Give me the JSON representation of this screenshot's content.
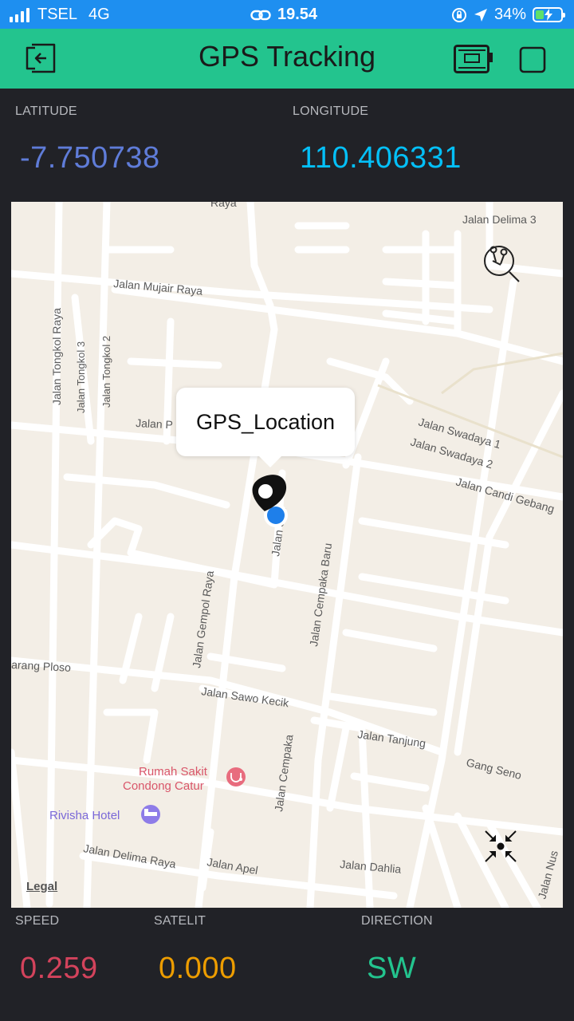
{
  "status_bar": {
    "carrier": "TSEL",
    "network": "4G",
    "time": "19.54",
    "battery_percent": "34%",
    "battery_level": 0.34
  },
  "header": {
    "title": "GPS Tracking",
    "back_icon": "exit-icon",
    "device_icon": "device-board-icon",
    "square_icon": "square-icon"
  },
  "coordinates": {
    "latitude_label": "LATITUDE",
    "latitude_value": "-7.750738",
    "longitude_label": "LONGITUDE",
    "longitude_value": "110.406331"
  },
  "map": {
    "marker_popup": "GPS_Location",
    "legal": "Legal",
    "streets": [
      "Jalan Delima 3",
      "Jalan Mujair Raya",
      "Jalan Tongkol Raya",
      "Jalan Tongkol 3",
      "Jalan Tongkol 2",
      "Jalan P",
      "Jalan Swadaya 1",
      "Jalan Swadaya 2",
      "Jalan Candi Gebang",
      "Jalan Cempaka Baru",
      "Jalan Gempol Raya",
      "arang Ploso",
      "Jalan Sawo Kecik",
      "Jalan Tanjung",
      "Gang Seno",
      "Jalan Cempaka",
      "Jalan Delima Raya",
      "Jalan Apel",
      "Jalan Dahlia",
      "Jalan Nus",
      "Jalan Sari",
      "Raya"
    ],
    "pois": {
      "hospital_line1": "Rumah Sakit",
      "hospital_line2": "Condong Catur",
      "hotel": "Rivisha Hotel"
    },
    "icons": [
      "map-search-icon",
      "recenter-icon",
      "hospital-icon",
      "hotel-icon",
      "location-pin-icon"
    ]
  },
  "stats": {
    "speed_label": "SPEED",
    "speed_value": "0.259",
    "satelit_label": "SATELIT",
    "satelit_value": "0.000",
    "direction_label": "DIRECTION",
    "direction_value": "SW"
  },
  "colors": {
    "status_bar": "#1E8FF0",
    "header": "#23C48E",
    "background": "#212227",
    "latitude": "#5F7CD8",
    "longitude": "#04C0F8",
    "speed": "#D3435C",
    "satelit": "#ED9D00",
    "direction": "#23C48E"
  }
}
